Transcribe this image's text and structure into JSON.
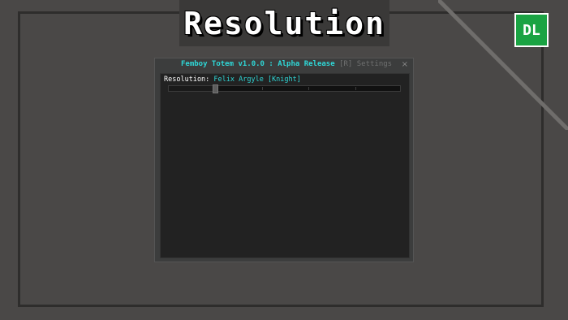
{
  "banner": {
    "title": "Resolution"
  },
  "badge": {
    "label": "DL",
    "color": "#1aa343"
  },
  "window": {
    "title": "Femboy Totem v1.0.0 : Alpha Release",
    "title_suffix": "[R] Settings",
    "close_glyph": "×"
  },
  "setting": {
    "label": "Resolution:",
    "value": "Felix Argyle [Knight]",
    "slider_level": 0.2,
    "tick_count": 5
  },
  "colors": {
    "accent": "#2fd6d6",
    "background": "#4a4847"
  }
}
